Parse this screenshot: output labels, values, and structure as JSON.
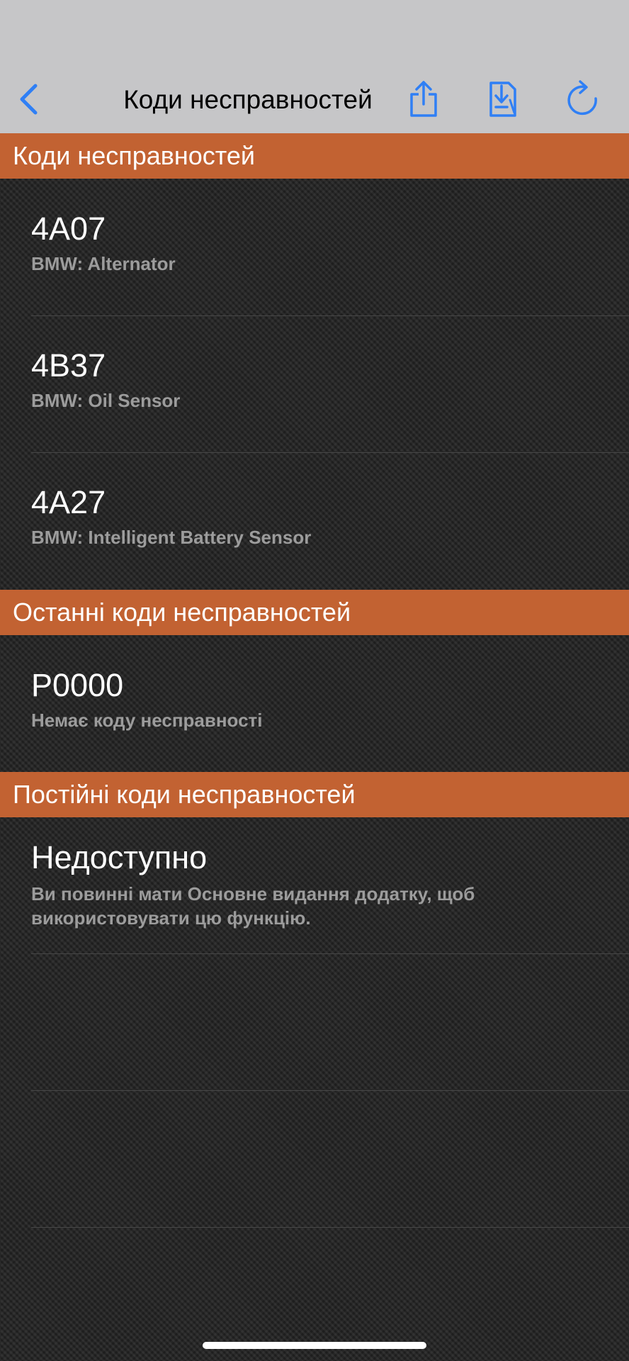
{
  "nav": {
    "title": "Коди несправностей",
    "icons": {
      "back": "chevron-left-icon",
      "share": "share-icon",
      "save": "save-document-icon",
      "refresh": "refresh-icon"
    },
    "accent_color": "#2f7ff5"
  },
  "sections": {
    "current": {
      "header": "Коди несправностей",
      "items": [
        {
          "code": "4A07",
          "desc": "BMW: Alternator"
        },
        {
          "code": "4B37",
          "desc": "BMW: Oil Sensor"
        },
        {
          "code": "4A27",
          "desc": "BMW: Intelligent Battery Sensor"
        }
      ]
    },
    "recent": {
      "header": "Останні коди несправностей",
      "items": [
        {
          "code": "P0000",
          "desc": "Немає коду несправності"
        }
      ]
    },
    "permanent": {
      "header": "Постійні коди несправностей",
      "items": [
        {
          "code": "Недоступно",
          "desc": "Ви повинні мати Основне видання додатку, щоб використовувати цю функцію."
        }
      ]
    }
  },
  "colors": {
    "section_header": "#c26232",
    "nav_background": "#c6c6c8"
  }
}
